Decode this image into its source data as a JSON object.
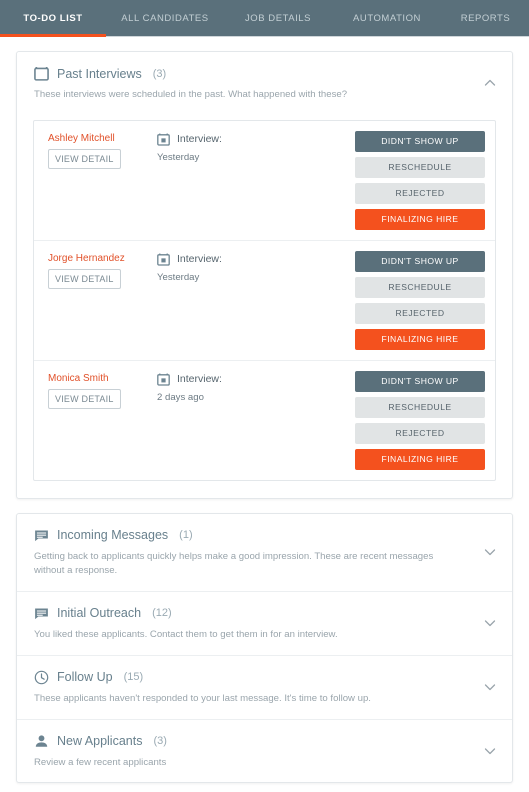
{
  "nav": {
    "tabs": [
      {
        "label": "TO-DO LIST",
        "active": true
      },
      {
        "label": "ALL CANDIDATES",
        "active": false
      },
      {
        "label": "JOB DETAILS",
        "active": false
      },
      {
        "label": "AUTOMATION",
        "active": false
      },
      {
        "label": "REPORTS",
        "active": false
      }
    ]
  },
  "colors": {
    "nav_background": "#5a707b",
    "accent_orange": "#f4511e",
    "slate": "#5a707b",
    "button_gray": "#e1e4e5",
    "candidate_name": "#e1512a"
  },
  "past_interviews": {
    "icon": "calendar-icon",
    "title": "Past Interviews",
    "count": "(3)",
    "description": "These interviews were scheduled in the past. What happened with these?",
    "toggle_icon": "chevron-up-icon",
    "rows": [
      {
        "name": "Ashley Mitchell",
        "view_detail": "VIEW DETAIL",
        "meta_icon": "calendar-event-icon",
        "meta_label": "Interview:",
        "meta_value": "Yesterday",
        "actions": [
          {
            "label": "DIDN'T SHOW UP",
            "style": "dark"
          },
          {
            "label": "RESCHEDULE",
            "style": "gray"
          },
          {
            "label": "REJECTED",
            "style": "gray"
          },
          {
            "label": "FINALIZING HIRE",
            "style": "orange"
          }
        ]
      },
      {
        "name": "Jorge Hernandez",
        "view_detail": "VIEW DETAIL",
        "meta_icon": "calendar-event-icon",
        "meta_label": "Interview:",
        "meta_value": "Yesterday",
        "actions": [
          {
            "label": "DIDN'T SHOW UP",
            "style": "dark"
          },
          {
            "label": "RESCHEDULE",
            "style": "gray"
          },
          {
            "label": "REJECTED",
            "style": "gray"
          },
          {
            "label": "FINALIZING HIRE",
            "style": "orange"
          }
        ]
      },
      {
        "name": "Monica Smith",
        "view_detail": "VIEW DETAIL",
        "meta_icon": "calendar-event-icon",
        "meta_label": "Interview:",
        "meta_value": "2 days ago",
        "actions": [
          {
            "label": "DIDN'T SHOW UP",
            "style": "dark"
          },
          {
            "label": "RESCHEDULE",
            "style": "gray"
          },
          {
            "label": "REJECTED",
            "style": "gray"
          },
          {
            "label": "FINALIZING HIRE",
            "style": "orange"
          }
        ]
      }
    ]
  },
  "collapsed_sections": [
    {
      "icon": "message-icon",
      "title": "Incoming Messages",
      "count": "(1)",
      "description": "Getting back to applicants quickly helps make a good impression. These are recent messages without a response.",
      "toggle_icon": "chevron-down-icon"
    },
    {
      "icon": "message-icon",
      "title": "Initial Outreach",
      "count": "(12)",
      "description": "You liked these applicants. Contact them to get them in for an interview.",
      "toggle_icon": "chevron-down-icon"
    },
    {
      "icon": "clock-icon",
      "title": "Follow Up",
      "count": "(15)",
      "description": "These applicants haven't responded to your last message. It's time to follow up.",
      "toggle_icon": "chevron-down-icon"
    },
    {
      "icon": "person-icon",
      "title": "New Applicants",
      "count": "(3)",
      "description": "Review a few recent applicants",
      "toggle_icon": "chevron-down-icon"
    }
  ]
}
